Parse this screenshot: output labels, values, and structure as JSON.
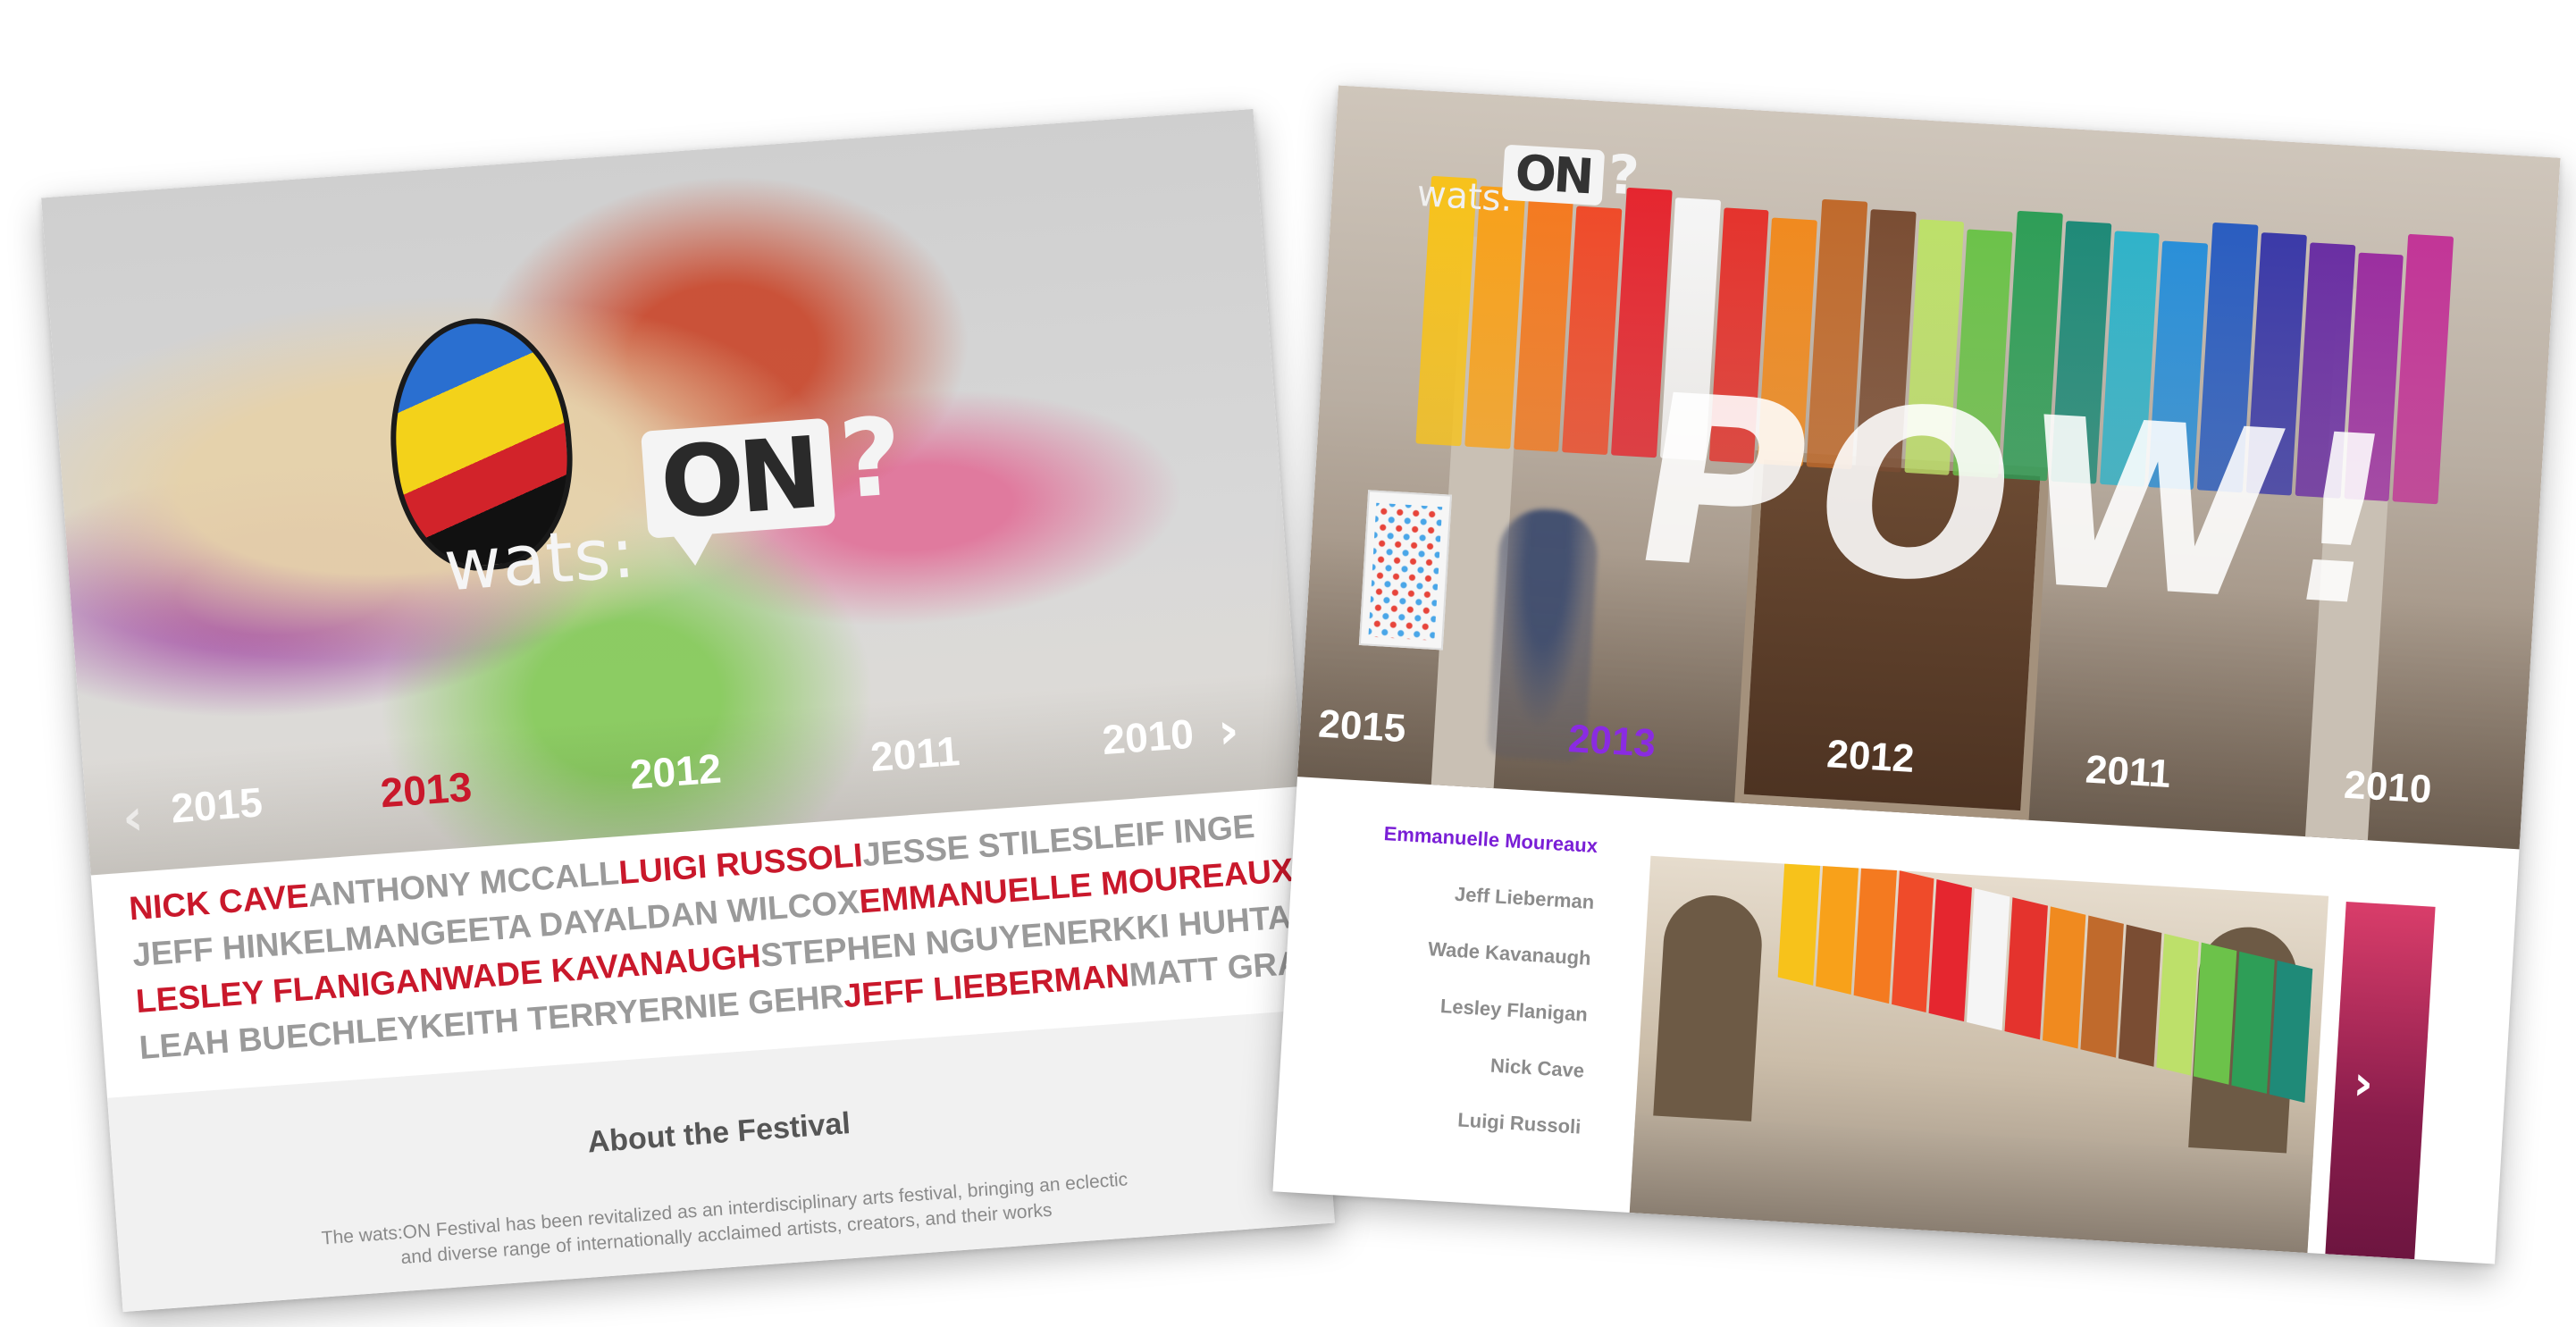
{
  "left": {
    "logo": {
      "wats": "wats:",
      "on": "ON",
      "q": "?"
    },
    "years": [
      "2015",
      "2013",
      "2012",
      "2011",
      "2010"
    ],
    "active_year": "2013",
    "artists": [
      [
        {
          "name": "NICK CAVE",
          "hl": true
        },
        {
          "name": "ANTHONY MCCALL",
          "hl": false
        },
        {
          "name": "LUIGI RUSSOLI",
          "hl": true
        },
        {
          "name": "JESSE STILES",
          "hl": false
        },
        {
          "name": "LEIF INGE",
          "hl": false
        }
      ],
      [
        {
          "name": "JEFF HINKELMAN",
          "hl": false
        },
        {
          "name": "GEETA DAYAL",
          "hl": false
        },
        {
          "name": "DAN WILCOX",
          "hl": false
        },
        {
          "name": "EMMANUELLE MOUREAUX",
          "hl": true
        }
      ],
      [
        {
          "name": "LESLEY FLANIGAN",
          "hl": true
        },
        {
          "name": "WADE KAVANAUGH",
          "hl": true
        },
        {
          "name": "STEPHEN NGUYEN",
          "hl": false
        },
        {
          "name": "ERKKI HUHTAMO",
          "hl": false
        }
      ],
      [
        {
          "name": "LEAH BUECHLEY",
          "hl": false
        },
        {
          "name": "KEITH TERRY",
          "hl": false
        },
        {
          "name": "ERNIE GEHR",
          "hl": false
        },
        {
          "name": "JEFF LIEBERMAN",
          "hl": true
        },
        {
          "name": "MATT GRAY",
          "hl": false
        }
      ]
    ],
    "about": {
      "title": "About the Festival",
      "text": "The wats:ON Festival has been revitalized as an interdisciplinary arts festival, bringing an eclectic and diverse range of internationally acclaimed artists, creators, and their works"
    },
    "colors": {
      "highlight": "#c9182b",
      "muted": "#9a9a9a"
    }
  },
  "right": {
    "logo": {
      "wats": "wats:",
      "on": "ON",
      "q": "?"
    },
    "headline": "POW!",
    "years": [
      "2015",
      "2013",
      "2012",
      "2011",
      "2010"
    ],
    "active_year": "2013",
    "artist_list": [
      "Emmanuelle Moureaux",
      "Jeff Lieberman",
      "Wade Kavanaugh",
      "Lesley Flanigan",
      "Nick Cave",
      "Luigi Russoli"
    ],
    "active_artist": "Emmanuelle Moureaux",
    "colors": {
      "active": "#7a1fd6"
    },
    "rainbow": [
      "#f7c21b",
      "#f8a11a",
      "#f47a20",
      "#ef4b2a",
      "#e5262f",
      "#f5f5f5",
      "#e4332d",
      "#f08a1f",
      "#c06a2c",
      "#7a4d33",
      "#bde06a",
      "#6cc24a",
      "#2e9e57",
      "#1f8a78",
      "#30b3c9",
      "#2a8fd8",
      "#2a5dc0",
      "#3b3aa8",
      "#6a2fa3",
      "#9b2fa0",
      "#c23597"
    ]
  }
}
